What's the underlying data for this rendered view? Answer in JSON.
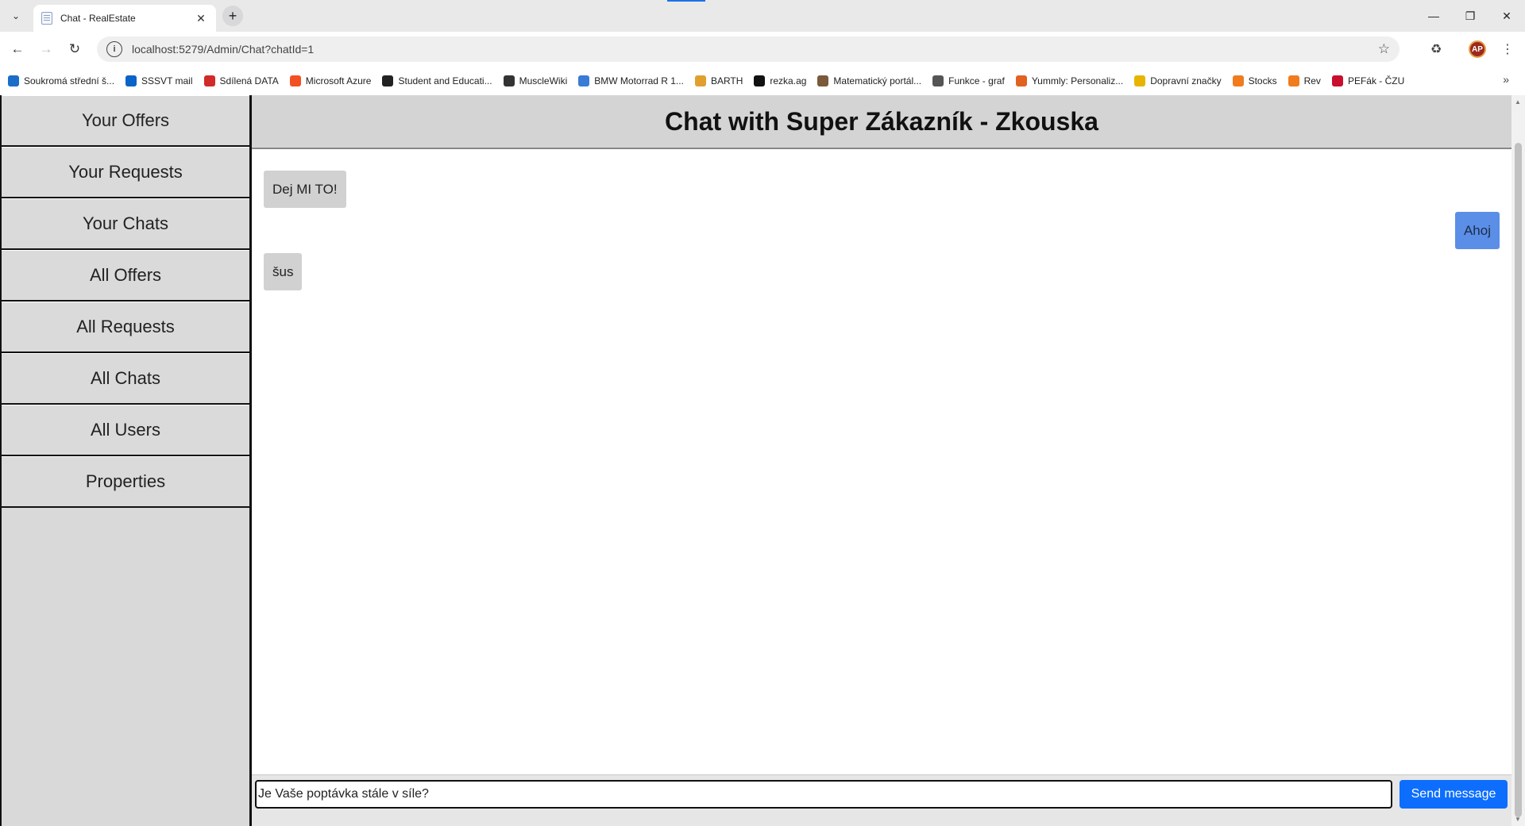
{
  "browser": {
    "tab_title": "Chat - RealEstate",
    "url": "localhost:5279/Admin/Chat?chatId=1",
    "avatar_initials": "AP",
    "bookmarks": [
      {
        "label": "Soukromá střední š...",
        "icon": "bookmark-icon",
        "color": "#1a6ec7"
      },
      {
        "label": "SSSVT mail",
        "icon": "outlook-icon",
        "color": "#0a64c8"
      },
      {
        "label": "Sdílená DATA",
        "icon": "data-icon",
        "color": "#d12a2a"
      },
      {
        "label": "Microsoft Azure",
        "icon": "microsoft-icon",
        "color": "#f25022"
      },
      {
        "label": "Student and Educati...",
        "icon": "education-icon",
        "color": "#222222"
      },
      {
        "label": "MuscleWiki",
        "icon": "musclewiki-icon",
        "color": "#333333"
      },
      {
        "label": "BMW Motorrad R 1...",
        "icon": "bmw-icon",
        "color": "#3a7bd5"
      },
      {
        "label": "BARTH",
        "icon": "barth-icon",
        "color": "#e0a030"
      },
      {
        "label": "rezka.ag",
        "icon": "hd-icon",
        "color": "#111111"
      },
      {
        "label": "Matematický portál...",
        "icon": "math-icon",
        "color": "#7a5a3a"
      },
      {
        "label": "Funkce - graf",
        "icon": "graph-icon",
        "color": "#555555"
      },
      {
        "label": "Yummly: Personaliz...",
        "icon": "yummly-icon",
        "color": "#e16120"
      },
      {
        "label": "Dopravní značky",
        "icon": "traffic-sign-icon",
        "color": "#e8b400"
      },
      {
        "label": "Stocks",
        "icon": "stocks-icon",
        "color": "#f07c1e"
      },
      {
        "label": "Rev",
        "icon": "rev-icon",
        "color": "#f07c1e"
      },
      {
        "label": "PEFák - ČZU",
        "icon": "czu-icon",
        "color": "#c8102e"
      }
    ]
  },
  "sidebar": {
    "items": [
      {
        "label": "Your Offers"
      },
      {
        "label": "Your Requests"
      },
      {
        "label": "Your Chats"
      },
      {
        "label": "All Offers"
      },
      {
        "label": "All Requests"
      },
      {
        "label": "All Chats"
      },
      {
        "label": "All Users"
      },
      {
        "label": "Properties"
      }
    ]
  },
  "chat": {
    "title": "Chat with Super Zákazník - Zkouska",
    "messages": [
      {
        "text": "Dej MI TO!",
        "direction": "in"
      },
      {
        "text": "Ahoj",
        "direction": "out"
      },
      {
        "text": "šus",
        "direction": "in"
      }
    ],
    "input_value": "Je Vaše poptávka stále v síle?",
    "send_label": "Send message"
  },
  "colors": {
    "sidebar_bg": "#d9d9d9",
    "header_bg": "#d4d4d4",
    "incoming_bubble": "#d1d1d1",
    "outgoing_bubble": "#5b8ee6",
    "send_button": "#0d6efd"
  }
}
